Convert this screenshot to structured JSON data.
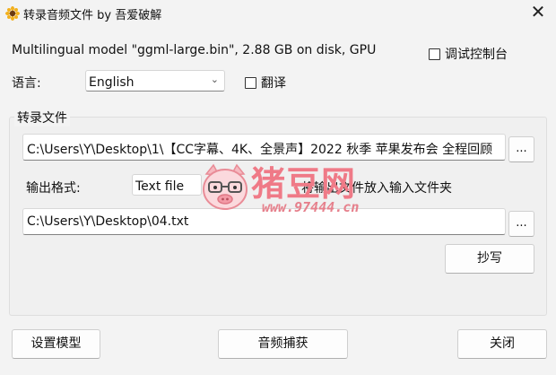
{
  "window": {
    "title": "转录音频文件 by 吾爱破解",
    "close_glyph": "✕"
  },
  "model_info": "Multilingual model \"ggml-large.bin\", 2.88 GB on disk, GPU",
  "debug_console": {
    "label": "调试控制台",
    "checked": false
  },
  "language": {
    "label": "语言:",
    "selected": "English",
    "translate_label": "翻译",
    "translate_checked": false
  },
  "transcribe_group": {
    "label": "转录文件",
    "input_path": "C:\\Users\\Y\\Desktop\\1\\【CC字幕、4K、全景声】2022 秋季 苹果发布会 全程回顾",
    "browse_input_label": "...",
    "output_format_label": "输出格式:",
    "output_format_selected": "Text file",
    "place_in_input_folder_label": "将输出文件放入输入文件夹",
    "output_path": "C:\\Users\\Y\\Desktop\\04.txt",
    "browse_output_label": "...",
    "transcribe_button": "抄写"
  },
  "watermark": {
    "name": "猪豆网",
    "url": "www.97444.cn"
  },
  "footer": {
    "setup_model": "设置模型",
    "audio_capture": "音频捕获",
    "close": "关闭"
  },
  "colors": {
    "watermark_pink": "#ef7a87"
  }
}
